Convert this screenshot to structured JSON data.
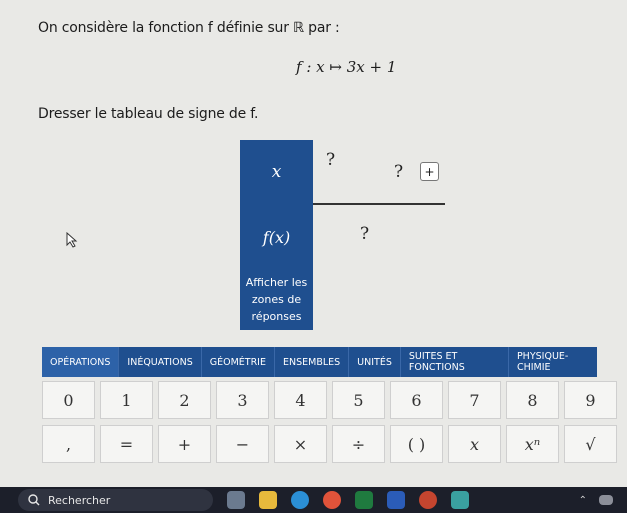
{
  "question": {
    "intro": "On considère la fonction f définie sur ℝ par :",
    "formula": "f : x ↦ 3x + 1",
    "task": "Dresser le tableau de signe de f."
  },
  "sign_table": {
    "x_label": "x",
    "fx_label": "f(x)",
    "value_1": "?",
    "value_2": "?",
    "sign": "?",
    "plus": "+",
    "zones_button": "Afficher les zones de réponses"
  },
  "tabs": [
    {
      "label": "OPÉRATIONS"
    },
    {
      "label": "INÉQUATIONS"
    },
    {
      "label": "GÉOMÉTRIE"
    },
    {
      "label": "ENSEMBLES"
    },
    {
      "label": "UNITÉS"
    },
    {
      "label": "SUITES ET FONCTIONS"
    },
    {
      "label": "PHYSIQUE-CHIMIE"
    }
  ],
  "keys_row1": [
    "0",
    "1",
    "2",
    "3",
    "4",
    "5",
    "6",
    "7",
    "8",
    "9"
  ],
  "keys_row2": [
    ",",
    "=",
    "+",
    "−",
    "×",
    "÷",
    "( )",
    "x",
    "xⁿ",
    "√"
  ],
  "taskbar": {
    "search_label": "Rechercher"
  },
  "colors": {
    "accent": "#1f4f8f",
    "background": "#e9e9e6"
  }
}
